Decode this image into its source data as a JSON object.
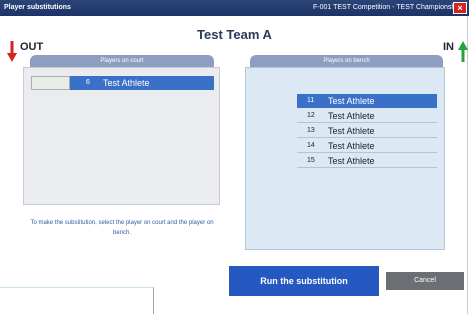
{
  "window": {
    "title": "Player substitutions",
    "competition": "F-001  TEST Competition - TEST Championship",
    "close_glyph": "×"
  },
  "team_name": "Test Team A",
  "labels": {
    "out": "OUT",
    "in": "IN"
  },
  "court": {
    "header": "Players on court",
    "players": [
      {
        "number": "6",
        "name": "Test Athlete",
        "selected": true
      }
    ],
    "hint": "To make the substitution, select the player on court and the player on bench."
  },
  "bench": {
    "header": "Players on bench",
    "players": [
      {
        "number": "11",
        "name": "Test Athlete",
        "selected": true
      },
      {
        "number": "12",
        "name": "Test Athlete",
        "selected": false
      },
      {
        "number": "13",
        "name": "Test Athlete",
        "selected": false
      },
      {
        "number": "14",
        "name": "Test Athlete",
        "selected": false
      },
      {
        "number": "15",
        "name": "Test Athlete",
        "selected": false
      }
    ]
  },
  "buttons": {
    "run": "Run the substitution",
    "cancel": "Cancel"
  },
  "colors": {
    "title_bar": "#1c3366",
    "selected_row": "#3b70c8",
    "run_button": "#2558c0",
    "cancel_button": "#6b6e72",
    "out_arrow": "#d6231d",
    "in_arrow": "#28a040",
    "bench_panel": "#dce8f4",
    "court_panel": "#eaecf0"
  }
}
